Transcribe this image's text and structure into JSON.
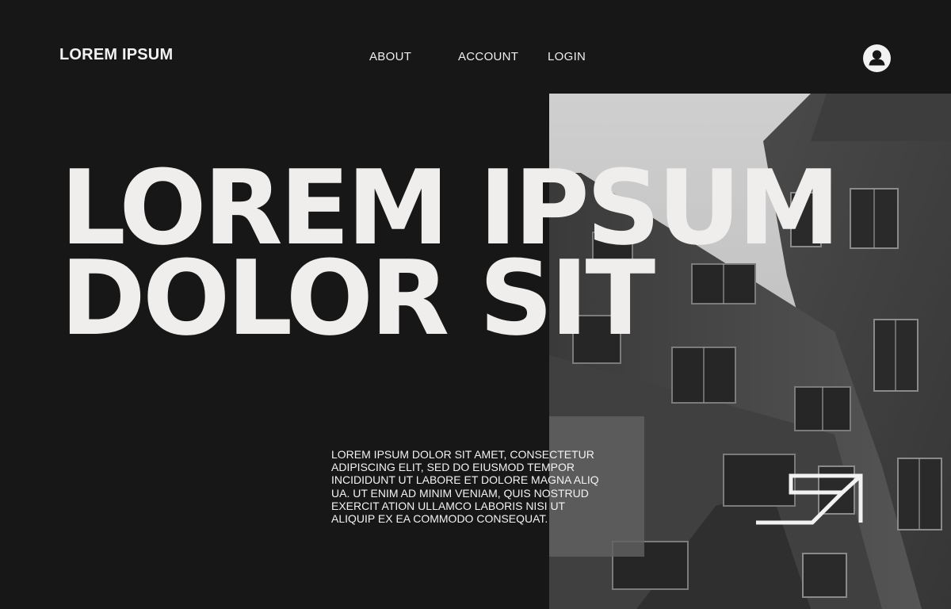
{
  "header": {
    "brand": "LOREM IPSUM",
    "nav": [
      {
        "label": "ABOUT"
      },
      {
        "label": "ACCOUNT"
      },
      {
        "label": "LOGIN"
      }
    ],
    "avatar_icon": "user-icon"
  },
  "hero": {
    "headline_line1": "LOREM IPSUM",
    "headline_line2": "DOLOR SIT",
    "body": "LOREM IPSUM DOLOR SIT AMET, CONSECTETUR\nADIPISCING ELIT, SED DO EIUSMOD TEMPOR\nINCIDIDUNT UT LABORE ET DOLORE MAGNA ALIQ\nUA. UT ENIM AD MINIM VENIAM, QUIS NOSTRUD\nEXERCIT ATION ULLAMCO LABORIS NISI UT\nALIQUIP EX EA COMMODO CONSEQUAT.",
    "arrow_icon": "arrow-up-right-icon",
    "photo": "black-and-white-building-photo"
  },
  "colors": {
    "background": "#171717",
    "text": "#efeeec",
    "overlay": "#626262"
  }
}
